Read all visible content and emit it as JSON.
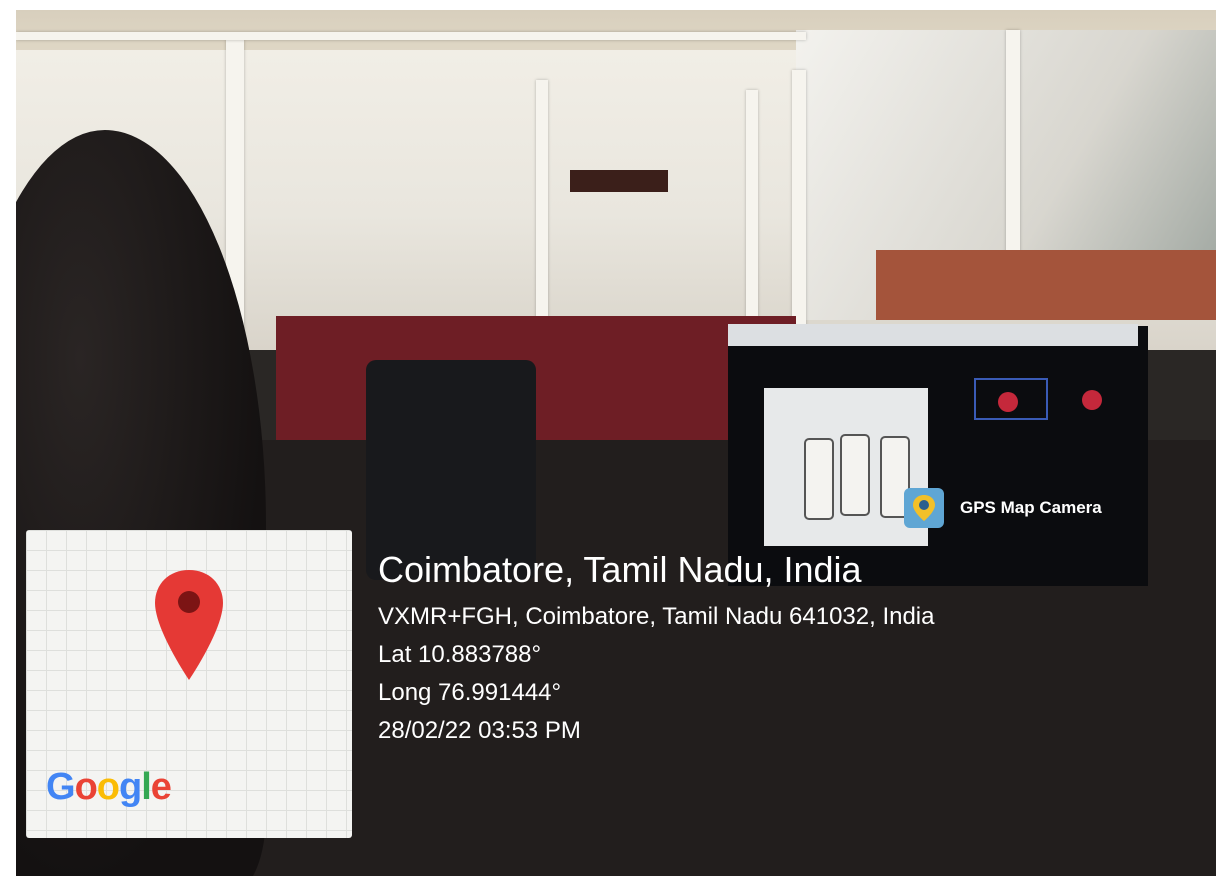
{
  "watermark": {
    "app_name": "GPS Map Camera",
    "app_icon": "gps-map-camera-icon",
    "map_thumbnail": {
      "pin_icon": "map-pin-icon",
      "logo": "Google",
      "pin_color": "#e53935"
    },
    "location_title": "Coimbatore, Tamil Nadu, India",
    "address": "VXMR+FGH, Coimbatore, Tamil Nadu 641032, India",
    "latitude": "Lat 10.883788°",
    "longitude": "Long 76.991444°",
    "datetime": "28/02/22 03:53 PM"
  }
}
